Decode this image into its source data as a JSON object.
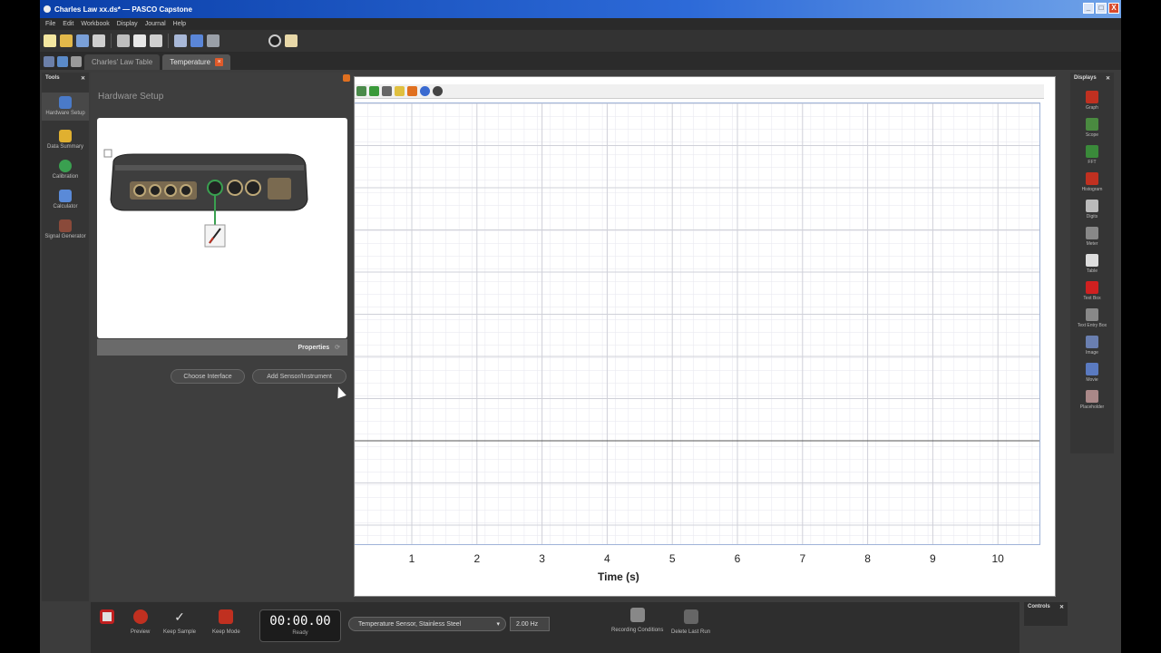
{
  "window": {
    "title": "Charles Law xx.ds* — PASCO Capstone",
    "controls": [
      "_",
      "□",
      "X"
    ]
  },
  "menu": [
    "File",
    "Edit",
    "Workbook",
    "Display",
    "Journal",
    "Help"
  ],
  "tabs": [
    {
      "label": "Charles' Law Table",
      "active": false
    },
    {
      "label": "Temperature",
      "active": true
    }
  ],
  "tools": {
    "title": "Tools",
    "items": [
      {
        "label": "Hardware Setup",
        "icon": "hardware-icon",
        "active": true
      },
      {
        "label": "Data Summary",
        "icon": "data-summary-icon",
        "active": false
      },
      {
        "label": "Calibration",
        "icon": "calibration-icon",
        "active": false
      },
      {
        "label": "Calculator",
        "icon": "calculator-icon",
        "active": false
      },
      {
        "label": "Signal Generator",
        "icon": "signal-generator-icon",
        "active": false
      }
    ]
  },
  "hardware": {
    "title": "Hardware Setup",
    "properties_label": "Properties",
    "choose_interface": "Choose Interface",
    "add_sensor": "Add Sensor/Instrument"
  },
  "graph": {
    "x_ticks": [
      "1",
      "2",
      "3",
      "4",
      "5",
      "6",
      "7",
      "8",
      "9",
      "10"
    ],
    "x_title": "Time (s)"
  },
  "displays": {
    "title": "Displays",
    "items": [
      {
        "label": "Graph",
        "icon": "graph-icon",
        "color": "#c03020"
      },
      {
        "label": "Scope",
        "icon": "scope-icon",
        "color": "#4a8a40"
      },
      {
        "label": "FFT",
        "icon": "fft-icon",
        "color": "#3a8a3a"
      },
      {
        "label": "Histogram",
        "icon": "histogram-icon",
        "color": "#c03020"
      },
      {
        "label": "Digits",
        "icon": "digits-icon",
        "color": "#bbbbbb"
      },
      {
        "label": "Meter",
        "icon": "meter-icon",
        "color": "#888888"
      },
      {
        "label": "Table",
        "icon": "table-icon",
        "color": "#dddddd"
      },
      {
        "label": "Text Box",
        "icon": "text-box-icon",
        "color": "#d02020"
      },
      {
        "label": "Text Entry Box",
        "icon": "text-entry-icon",
        "color": "#888888"
      },
      {
        "label": "Image",
        "icon": "image-icon",
        "color": "#6a7fb0"
      },
      {
        "label": "Movie",
        "icon": "movie-icon",
        "color": "#5a7ac0"
      },
      {
        "label": "Placeholder",
        "icon": "placeholder-icon",
        "color": "#aa8888"
      }
    ]
  },
  "controls": {
    "title": "Controls",
    "preview": "Preview",
    "keep_sample": "Keep Sample",
    "keep_mode": "Keep Mode",
    "timer": "00:00.00",
    "status": "Ready",
    "sensor": "Temperature Sensor, Stainless Steel",
    "rate": "2.00 Hz",
    "recording_conditions": "Recording Conditions",
    "delete_last_run": "Delete Last Run"
  }
}
